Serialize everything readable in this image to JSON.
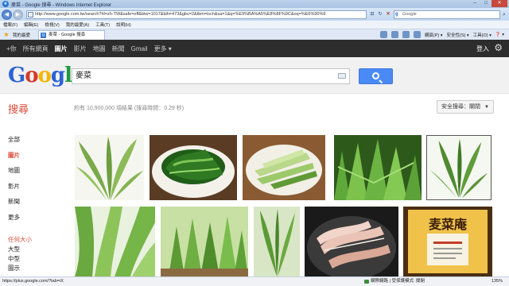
{
  "window": {
    "title": "麥菜 - Google 搜尋 - Windows Internet Explorer",
    "controls": [
      "–",
      "□",
      "✕"
    ]
  },
  "address_bar": {
    "url": "http://www.google.com.tw/search?hl=zh-TW&safe=off&biw=1017&bih=473&gbv=2&tbm=isch&sa=1&q=%E9%BA%A5%E8%8F%9C&oq=%E6%90%9",
    "search_placeholder": "Google"
  },
  "menu_bar": [
    "檔案(F)",
    "編輯(E)",
    "檢視(V)",
    "我的最愛(A)",
    "工具(T)",
    "說明(H)"
  ],
  "favorites": {
    "link_label": "我的最愛",
    "tab_label": "麥菜 - Google 搜尋"
  },
  "command_bar": [
    "網頁(P) ▾",
    "安全性(S) ▾",
    "工具(O) ▾",
    "❓ ▾"
  ],
  "google_bar": {
    "items": [
      "+你",
      "所有網頁",
      "圖片",
      "影片",
      "地圖",
      "新聞",
      "Gmail"
    ],
    "active_index": 2,
    "more_label": "更多 ▾",
    "signin_label": "登入"
  },
  "search": {
    "logo_letters": [
      "G",
      "o",
      "o",
      "g",
      "l",
      "e"
    ],
    "query": "麥菜"
  },
  "results": {
    "section_title": "搜尋",
    "count_text": "約有 10,900,000 項結果 (搜尋時間：0.29 秒)",
    "safesearch_label": "安全搜尋：關閉"
  },
  "left_nav": {
    "items": [
      "全部",
      "圖片",
      "地圖",
      "影片",
      "新聞",
      "更多"
    ],
    "active_index": 1,
    "size_heading": "任何大小",
    "size_options": [
      "大型",
      "中型",
      "圖示"
    ]
  },
  "images": [
    {
      "name": "lettuce-leaves-plain"
    },
    {
      "name": "stir-fried-lettuce-plate"
    },
    {
      "name": "lettuce-stems-plate"
    },
    {
      "name": "lettuce-field"
    },
    {
      "name": "lettuce-bunch"
    },
    {
      "name": "lettuce-leaves-closeup"
    },
    {
      "name": "lettuce-seedlings"
    },
    {
      "name": "lettuce-with-watermark"
    },
    {
      "name": "bacon-pan"
    },
    {
      "name": "restaurant-sign",
      "sign_title": "麦菜庵"
    }
  ],
  "status_bar": {
    "url": "https://plus.google.com/?tab=iX",
    "zone": "網際網路 | 受保護模式: 關閉",
    "zoom": "135%"
  }
}
